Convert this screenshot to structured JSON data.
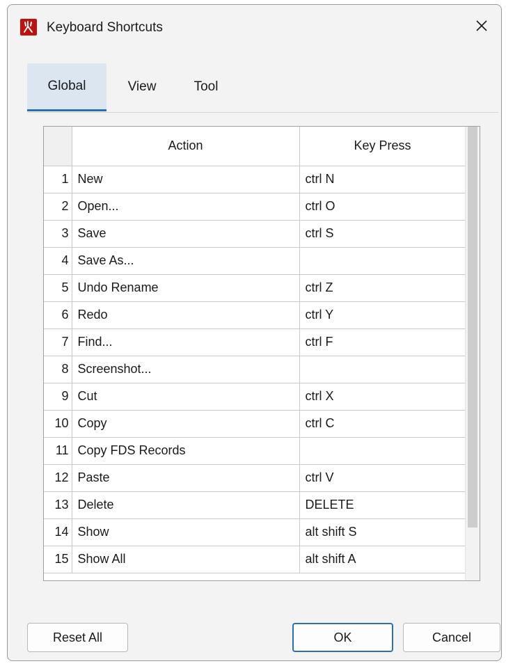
{
  "window": {
    "title": "Keyboard Shortcuts"
  },
  "icons": {
    "app": "app-logo-icon",
    "close": "close-icon"
  },
  "tabs": [
    {
      "label": "Global",
      "active": true
    },
    {
      "label": "View",
      "active": false
    },
    {
      "label": "Tool",
      "active": false
    }
  ],
  "table": {
    "columns": [
      "",
      "Action",
      "Key Press"
    ],
    "rows": [
      {
        "num": "1",
        "action": "New",
        "key": "ctrl N"
      },
      {
        "num": "2",
        "action": "Open...",
        "key": "ctrl O"
      },
      {
        "num": "3",
        "action": "Save",
        "key": "ctrl S"
      },
      {
        "num": "4",
        "action": "Save As...",
        "key": ""
      },
      {
        "num": "5",
        "action": "Undo Rename",
        "key": "ctrl Z"
      },
      {
        "num": "6",
        "action": "Redo",
        "key": "ctrl Y"
      },
      {
        "num": "7",
        "action": "Find...",
        "key": "ctrl F"
      },
      {
        "num": "8",
        "action": "Screenshot...",
        "key": ""
      },
      {
        "num": "9",
        "action": "Cut",
        "key": "ctrl X"
      },
      {
        "num": "10",
        "action": "Copy",
        "key": "ctrl C"
      },
      {
        "num": "11",
        "action": "Copy FDS Records",
        "key": ""
      },
      {
        "num": "12",
        "action": "Paste",
        "key": "ctrl V"
      },
      {
        "num": "13",
        "action": "Delete",
        "key": "DELETE"
      },
      {
        "num": "14",
        "action": "Show",
        "key": "alt shift S"
      },
      {
        "num": "15",
        "action": "Show All",
        "key": "alt shift A"
      }
    ]
  },
  "buttons": {
    "reset_all": "Reset All",
    "ok": "OK",
    "cancel": "Cancel"
  },
  "colors": {
    "accent": "#2a6fb0",
    "app_icon": "#c0100f",
    "active_tab_bg": "#dce6f0"
  }
}
